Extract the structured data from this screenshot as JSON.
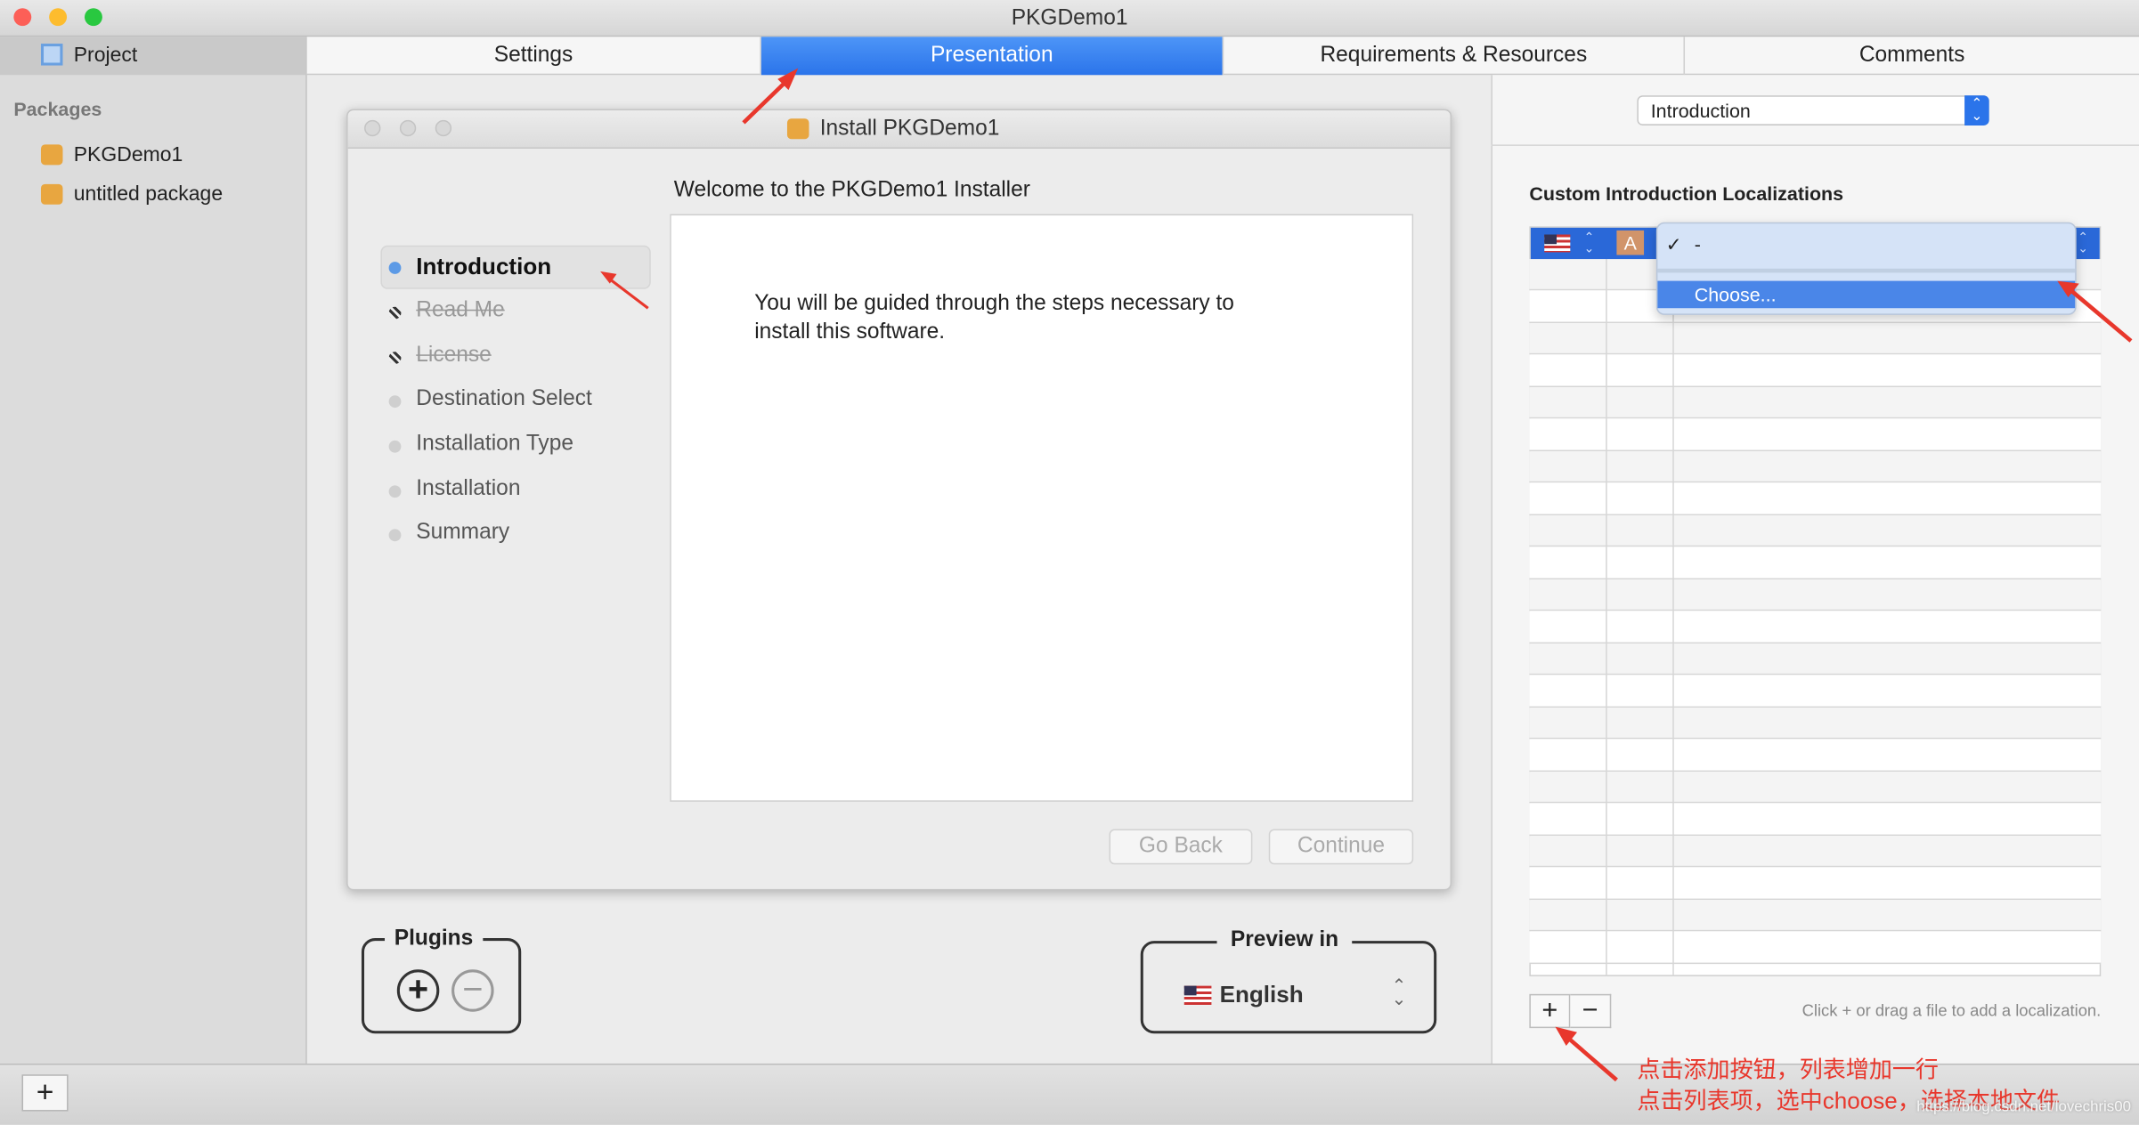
{
  "window": {
    "title": "PKGDemo1"
  },
  "sidebar": {
    "project": "Project",
    "packages_header": "Packages",
    "packages": [
      "PKGDemo1",
      "untitled package"
    ]
  },
  "tabs": [
    {
      "label": "Settings"
    },
    {
      "label": "Presentation",
      "selected": true
    },
    {
      "label": "Requirements & Resources"
    },
    {
      "label": "Comments"
    }
  ],
  "installer": {
    "title": "Install PKGDemo1",
    "heading": "Welcome to the PKGDemo1 Installer",
    "steps": [
      {
        "label": "Introduction",
        "state": "current"
      },
      {
        "label": "Read Me",
        "state": "disabled"
      },
      {
        "label": "License",
        "state": "disabled"
      },
      {
        "label": "Destination Select"
      },
      {
        "label": "Installation Type"
      },
      {
        "label": "Installation"
      },
      {
        "label": "Summary"
      }
    ],
    "body_line1": "You will be guided through the steps necessary to",
    "body_line2": "install this software.",
    "go_back": "Go Back",
    "continue": "Continue"
  },
  "plugins": {
    "label": "Plugins"
  },
  "preview": {
    "label": "Preview in",
    "language": "English"
  },
  "right": {
    "section_popup": "Introduction",
    "table_title": "Custom Introduction Localizations",
    "menu": {
      "items": [
        {
          "label": "-",
          "checked": true
        },
        {
          "label": "Choose...",
          "highlighted": true
        }
      ]
    },
    "hint": "Click + or drag a file to add a localization.",
    "add": "+",
    "remove": "−"
  },
  "bottom": {
    "add": "+"
  },
  "annotations": {
    "line1": "点击添加按钮，列表增加一行",
    "line2": "点击列表项，选中choose，选择本地文件",
    "color": "#e8372c"
  },
  "watermark": "https://blog.csdn.net/lovechris00",
  "colors": {
    "accent": "#2b74ea",
    "menu_highlight": "#4a86e8"
  }
}
